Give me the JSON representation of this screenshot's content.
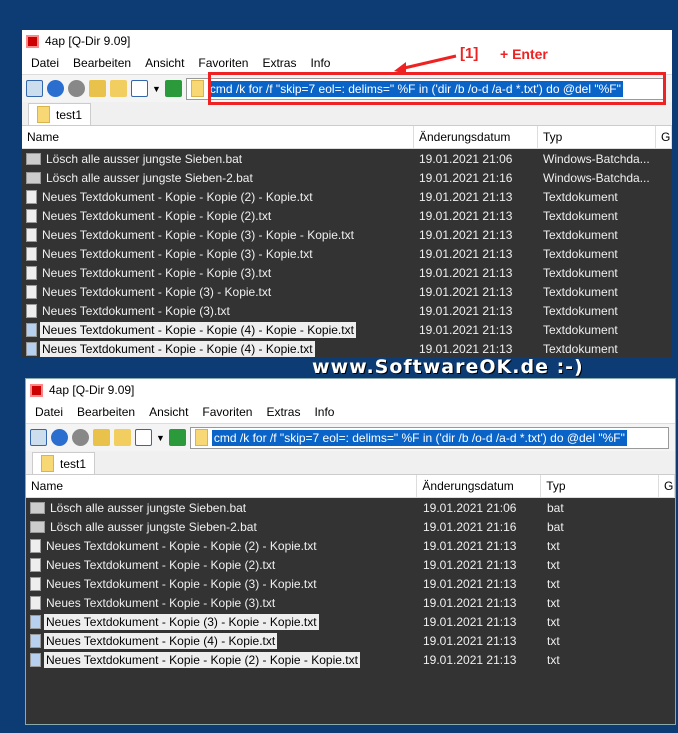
{
  "annotation": {
    "step": "[1]",
    "key": "+ Enter",
    "arrow_color": "#e22222"
  },
  "brand": "www.SoftwareOK.de :-)",
  "menu": [
    "Datei",
    "Bearbeiten",
    "Ansicht",
    "Favoriten",
    "Extras",
    "Info"
  ],
  "top": {
    "title": "4ap  [Q-Dir 9.09]",
    "address": "cmd /k for /f \"skip=7 eol=: delims=\" %F in ('dir /b /o-d /a-d *.txt') do @del \"%F\"",
    "tab": "test1",
    "columns": [
      "Name",
      "Änderungsdatum",
      "Typ",
      "G"
    ],
    "rows": [
      [
        "Lösch alle ausser jungste Sieben.bat",
        "19.01.2021 21:06",
        "Windows-Batchda...",
        "bat",
        false
      ],
      [
        "Lösch alle ausser jungste Sieben-2.bat",
        "19.01.2021 21:16",
        "Windows-Batchda...",
        "bat",
        false
      ],
      [
        "Neues Textdokument - Kopie - Kopie (2) - Kopie.txt",
        "19.01.2021 21:13",
        "Textdokument",
        "txt",
        false
      ],
      [
        "Neues Textdokument - Kopie - Kopie (2).txt",
        "19.01.2021 21:13",
        "Textdokument",
        "txt",
        false
      ],
      [
        "Neues Textdokument - Kopie - Kopie (3) - Kopie - Kopie.txt",
        "19.01.2021 21:13",
        "Textdokument",
        "txt",
        false
      ],
      [
        "Neues Textdokument - Kopie - Kopie (3) - Kopie.txt",
        "19.01.2021 21:13",
        "Textdokument",
        "txt",
        false
      ],
      [
        "Neues Textdokument - Kopie - Kopie (3).txt",
        "19.01.2021 21:13",
        "Textdokument",
        "txt",
        false
      ],
      [
        "Neues Textdokument - Kopie (3) - Kopie.txt",
        "19.01.2021 21:13",
        "Textdokument",
        "txt",
        false
      ],
      [
        "Neues Textdokument - Kopie (3).txt",
        "19.01.2021 21:13",
        "Textdokument",
        "txt",
        false
      ],
      [
        "Neues Textdokument - Kopie - Kopie (4) - Kopie - Kopie.txt",
        "19.01.2021 21:13",
        "Textdokument",
        "txt",
        true
      ],
      [
        "Neues Textdokument - Kopie - Kopie (4) - Kopie.txt",
        "19.01.2021 21:13",
        "Textdokument",
        "txt",
        true
      ]
    ]
  },
  "bottom": {
    "title": "4ap  [Q-Dir 9.09]",
    "address": "cmd /k for /f \"skip=7 eol=: delims=\" %F in ('dir /b /o-d /a-d *.txt') do @del \"%F\"",
    "tab": "test1",
    "columns": [
      "Name",
      "Änderungsdatum",
      "Typ",
      "G"
    ],
    "rows": [
      [
        "Lösch alle ausser jungste Sieben.bat",
        "19.01.2021 21:06",
        "bat",
        "bat",
        false
      ],
      [
        "Lösch alle ausser jungste Sieben-2.bat",
        "19.01.2021 21:16",
        "bat",
        "bat",
        false
      ],
      [
        "Neues Textdokument - Kopie - Kopie (2) - Kopie.txt",
        "19.01.2021 21:13",
        "txt",
        "txt",
        false
      ],
      [
        "Neues Textdokument - Kopie - Kopie (2).txt",
        "19.01.2021 21:13",
        "txt",
        "txt",
        false
      ],
      [
        "Neues Textdokument - Kopie - Kopie (3) - Kopie.txt",
        "19.01.2021 21:13",
        "txt",
        "txt",
        false
      ],
      [
        "Neues Textdokument - Kopie - Kopie (3).txt",
        "19.01.2021 21:13",
        "txt",
        "txt",
        false
      ],
      [
        "Neues Textdokument - Kopie (3) - Kopie - Kopie.txt",
        "19.01.2021 21:13",
        "txt",
        "txt",
        true
      ],
      [
        "Neues Textdokument - Kopie (4) - Kopie.txt",
        "19.01.2021 21:13",
        "txt",
        "txt",
        true
      ],
      [
        "Neues Textdokument - Kopie - Kopie (2) - Kopie - Kopie.txt",
        "19.01.2021 21:13",
        "txt",
        "txt",
        true
      ]
    ]
  }
}
